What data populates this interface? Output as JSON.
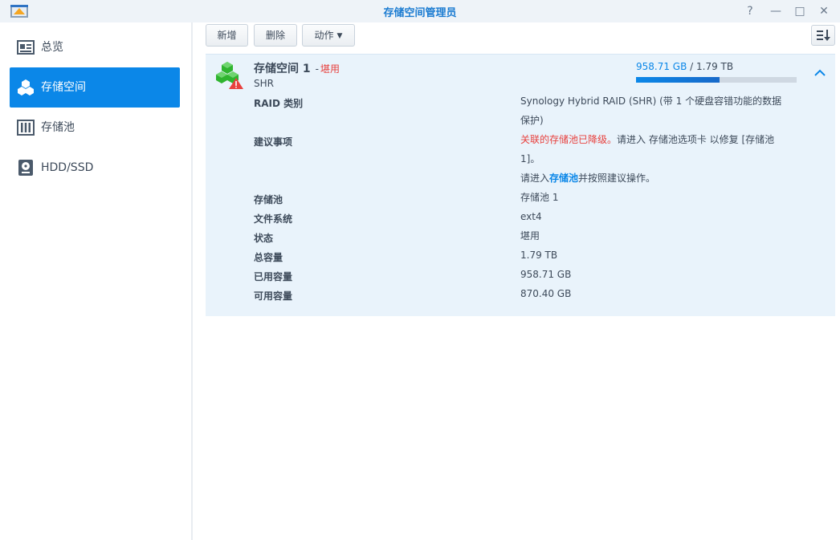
{
  "window": {
    "title": "存储空间管理员",
    "controls": [
      "?",
      "—",
      "□",
      "✕"
    ]
  },
  "sidebar": {
    "items": [
      {
        "label": "总览",
        "icon": "overview-icon",
        "active": false
      },
      {
        "label": "存储空间",
        "icon": "volume-icon",
        "active": true
      },
      {
        "label": "存储池",
        "icon": "storage-pool-icon",
        "active": false
      },
      {
        "label": "HDD/SSD",
        "icon": "disk-icon",
        "active": false
      }
    ]
  },
  "toolbar": {
    "create_label": "新增",
    "delete_label": "删除",
    "action_label": "动作"
  },
  "volume": {
    "name": "存储空间 1",
    "separator": "-",
    "status": "堪用",
    "type": "SHR",
    "usage": {
      "used": "958.71 GB",
      "slash": " / ",
      "total": "1.79 TB",
      "fraction": 0.52
    },
    "details": {
      "raid_type": {
        "label": "RAID 类别",
        "value": "Synology Hybrid RAID (SHR) (带 1 个硬盘容错功能的数据保护)"
      },
      "suggestion": {
        "label": "建议事项",
        "warning": "关联的存储池已降级。",
        "line1_rest": "请进入 存储池选项卡 以修复 [存储池 1]。",
        "line2_prefix": "请进入",
        "line2_link": "存储池",
        "line2_suffix": "并按照建议操作。"
      },
      "pool": {
        "label": "存储池",
        "value": "存储池 1"
      },
      "filesystem": {
        "label": "文件系统",
        "value": "ext4"
      },
      "status": {
        "label": "状态",
        "value": "堪用"
      },
      "total_capacity": {
        "label": "总容量",
        "value": "1.79 TB"
      },
      "used_capacity": {
        "label": "已用容量",
        "value": "958.71 GB"
      },
      "free_capacity": {
        "label": "可用容量",
        "value": "870.40 GB"
      }
    }
  },
  "colors": {
    "accent": "#0b87e8",
    "warning": "#e8413e",
    "panel": "#e9f3fb"
  }
}
